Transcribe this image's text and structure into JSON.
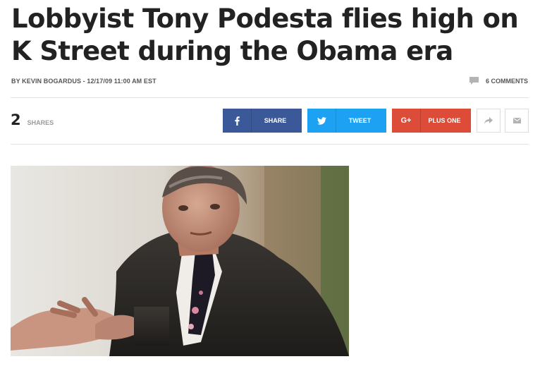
{
  "article": {
    "headline": "Lobbyist Tony Podesta flies high on K Street during the Obama era",
    "byline": "BY KEVIN BOGARDUS - 12/17/09 11:00 AM EST",
    "comments": "6 COMMENTS"
  },
  "share": {
    "count": "2",
    "count_label": "SHARES",
    "facebook_label": "SHARE",
    "twitter_label": "TWEET",
    "google_label": "PLUS ONE",
    "google_icon": "G+"
  },
  "icons": {
    "comment": "comment-icon",
    "facebook": "facebook-icon",
    "twitter": "twitter-icon",
    "google": "google-plus-icon",
    "share": "share-arrow-icon",
    "email": "email-icon"
  },
  "colors": {
    "facebook": "#3b5998",
    "twitter": "#1da1f2",
    "google": "#dd4b39"
  }
}
